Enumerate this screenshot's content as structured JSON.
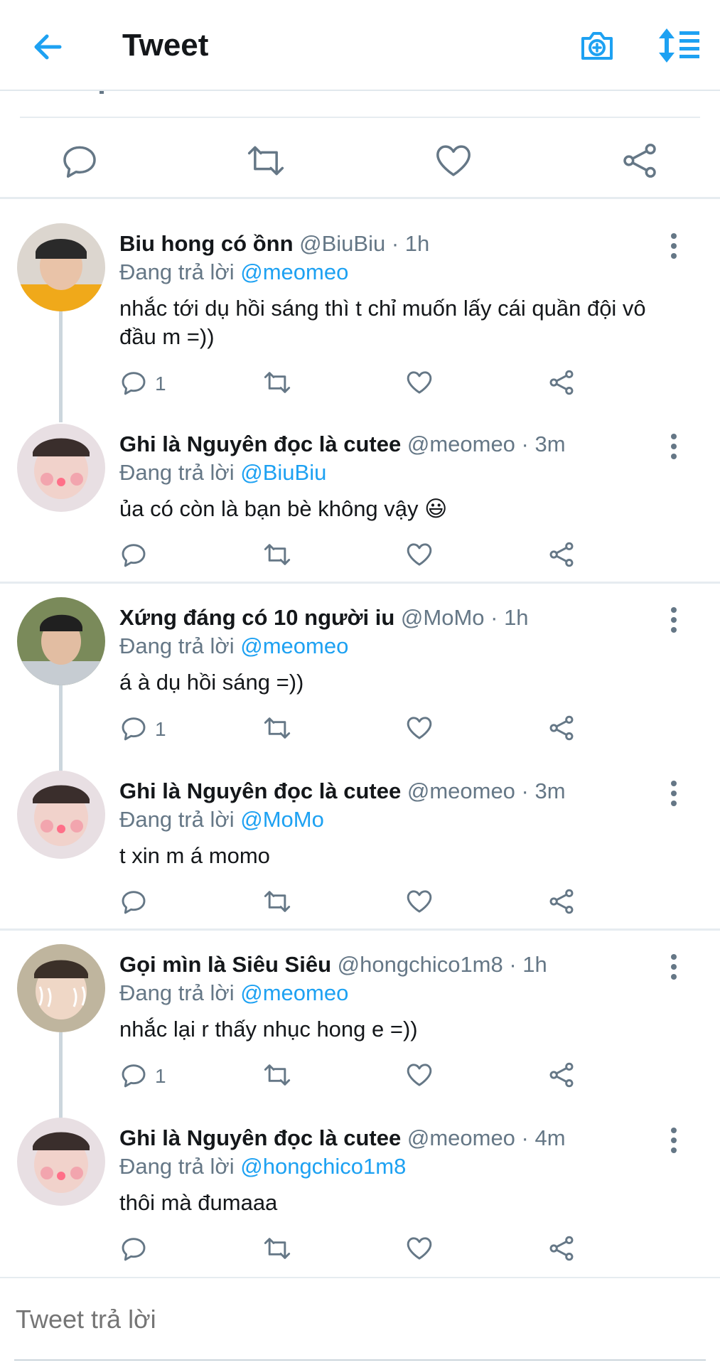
{
  "header": {
    "title": "Tweet"
  },
  "replies": [
    {
      "name": "Biu hong có ồnn",
      "handle": "@BiuBiu · 1h",
      "replying_label": "Đang trả lời",
      "replying_to": "@meomeo",
      "text": "nhắc tới dụ hồi sáng thì t chỉ muốn lấy cái quần đội vô đầu m =))",
      "reply_count": "1"
    },
    {
      "name": "Ghi là Nguyên đọc là cutee",
      "handle": "@meomeo · 3m",
      "replying_label": "Đang trả lời",
      "replying_to": "@BiuBiu",
      "text": "ủa có còn là bạn bè không vậy 😃",
      "reply_count": ""
    },
    {
      "name": "Xứng đáng có 10 người iu",
      "handle": "@MoMo · 1h",
      "replying_label": "Đang trả lời",
      "replying_to": "@meomeo",
      "text": "á à dụ hồi sáng =))",
      "reply_count": "1"
    },
    {
      "name": "Ghi là Nguyên đọc là cutee",
      "handle": "@meomeo · 3m",
      "replying_label": "Đang trả lời",
      "replying_to": "@MoMo",
      "text": "t xin m á momo",
      "reply_count": ""
    },
    {
      "name": "Gọi mìn là Siêu Siêu",
      "handle": "@hongchico1m8 · 1h",
      "replying_label": "Đang trả lời",
      "replying_to": "@meomeo",
      "text": "nhắc lại r thấy nhục hong e =))",
      "reply_count": "1"
    },
    {
      "name": "Ghi là Nguyên đọc là cutee",
      "handle": "@meomeo · 4m",
      "replying_label": "Đang trả lời",
      "replying_to": "@hongchico1m8",
      "text": "thôi mà đumaaa",
      "reply_count": ""
    }
  ],
  "composer": {
    "placeholder": "Tweet trả lời"
  },
  "colors": {
    "accent": "#1da1f2",
    "muted": "#657786",
    "text": "#14171a"
  }
}
